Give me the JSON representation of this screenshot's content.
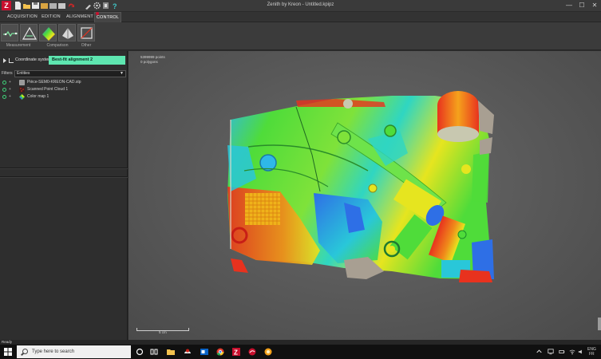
{
  "app": {
    "title": "Zenith by Kreon - Untitled.kpipz",
    "logo": "Z",
    "quick_access": [
      "new-file-icon",
      "open-folder-icon",
      "save-icon",
      "import-icon",
      "export-icon",
      "redo-icon",
      "settings-icon",
      "filter-icon",
      "help-icon"
    ]
  },
  "window_controls": {
    "minimize": "—",
    "maximize": "☐",
    "close": "✕"
  },
  "tabs": [
    {
      "label": "ACQUISITION"
    },
    {
      "label": "EDITION"
    },
    {
      "label": "ALIGNMENT"
    },
    {
      "label": "CONTROL"
    }
  ],
  "active_tab": "CONTROL",
  "ribbon": {
    "groups": [
      {
        "label": "Measurement",
        "icon": "measurement-icon"
      },
      {
        "label": "Comparison",
        "icon": "comparison-icon"
      },
      {
        "label": "Other",
        "icon": "other-icon"
      }
    ]
  },
  "left_panel": {
    "coordinate_label": "Coordinate system",
    "alignment_value": "Best-fit alignment 2",
    "filter_label": "Filters",
    "filter_value": "Entities",
    "items": [
      {
        "label": "Pièce-SEM0-KREON-CAD.stp",
        "icon": "cad-model-icon"
      },
      {
        "label": "Scanned Point Cloud 1",
        "icon": "point-cloud-icon"
      },
      {
        "label": "Color map 1",
        "icon": "color-map-icon"
      }
    ]
  },
  "viewport": {
    "info_points": "5399999 points",
    "info_polygons": "0 polygons",
    "scale_label": "5 cm",
    "colors": {
      "red": "#e8321e",
      "orange": "#f08a1a",
      "yellow": "#e6e51f",
      "green": "#4fdc3a",
      "cyan": "#29c7d9",
      "blue": "#2e6fe6",
      "gray": "#a89f92"
    }
  },
  "status": {
    "text": "Ready"
  },
  "taskbar": {
    "search_placeholder": "Type here to search",
    "apps": [
      "task-view-icon",
      "file-explorer-icon",
      "mail-icon",
      "outlook-icon",
      "chrome-icon",
      "zenith-icon",
      "kreon-icon",
      "photos-icon"
    ],
    "lang_top": "ENG",
    "lang_bottom": "FR"
  }
}
